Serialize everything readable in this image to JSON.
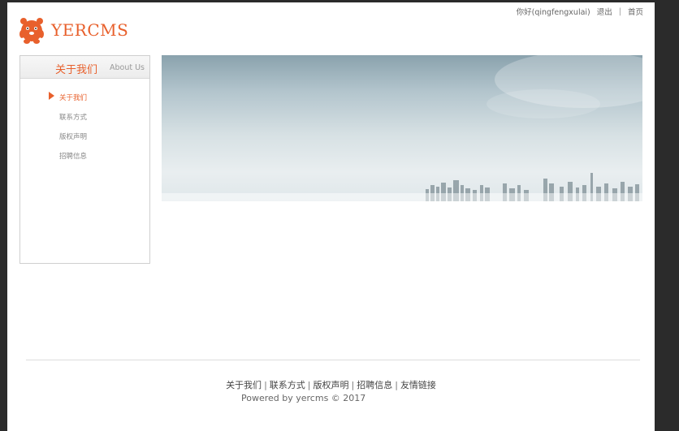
{
  "header": {
    "greeting": "你好(qingfengxulai)",
    "logout": "退出",
    "separator": "|",
    "home": "首页"
  },
  "logo": {
    "text": "YERCMS",
    "icon": "bear-mascot-icon",
    "color": "#e8602c"
  },
  "sidebar": {
    "title_cn": "关于我们",
    "title_en": "About Us",
    "items": [
      {
        "label": "关于我们",
        "active": true
      },
      {
        "label": "联系方式",
        "active": false
      },
      {
        "label": "版权声明",
        "active": false
      },
      {
        "label": "招聘信息",
        "active": false
      }
    ]
  },
  "banner": {
    "icon": "city-skyline-image"
  },
  "footer": {
    "links": [
      "关于我们",
      "联系方式",
      "版权声明",
      "招聘信息",
      "友情链接"
    ],
    "separator": "|",
    "copyright": "Powered by yercms © 2017"
  },
  "colors": {
    "accent": "#e8602c",
    "text_muted": "#888888"
  }
}
